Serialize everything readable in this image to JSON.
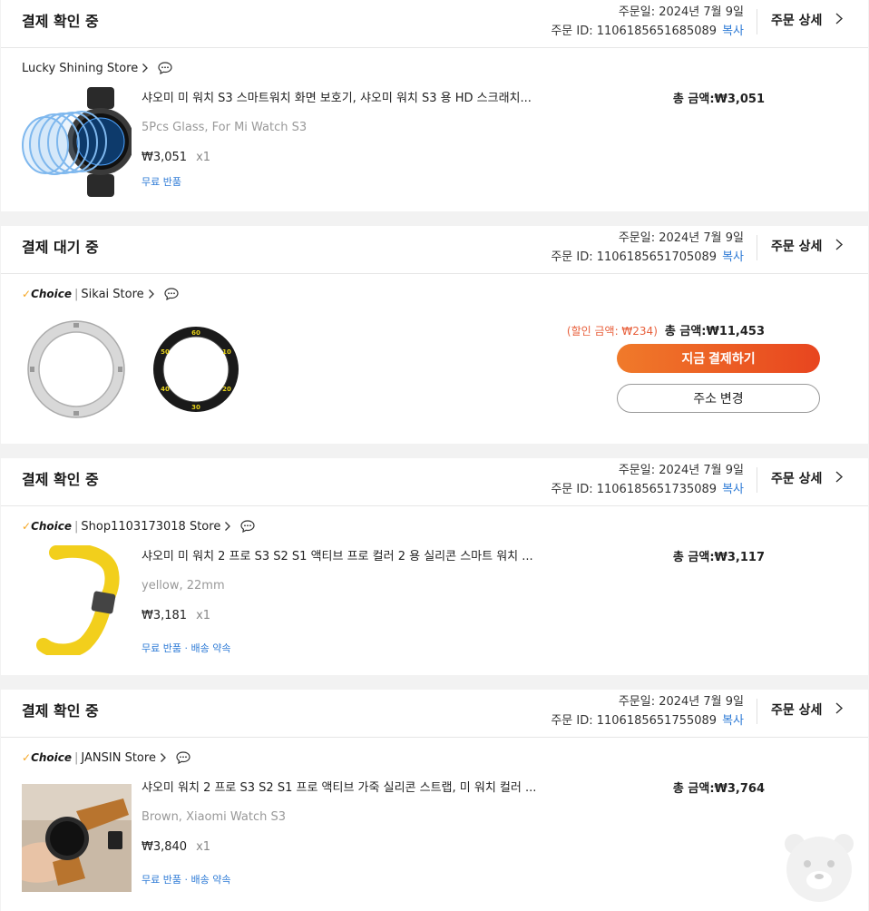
{
  "orders": [
    {
      "status": "결제 확인 중",
      "order_date": "주문일: 2024년 7월 9일",
      "order_id": "주문 ID: 1106185651685089",
      "copy_label": "복사",
      "detail_label": "주문 상세",
      "store": "Lucky Shining Store",
      "choice": false,
      "title": "샤오미 미 워치 S3 스마트워치 화면 보호기, 샤오미 워치 S3 용 HD 스크래치...",
      "variant": "5Pcs Glass, For Mi Watch S3",
      "price": "₩3,051",
      "qty": "x1",
      "benefits": "무료 반품",
      "total": "총 금액:₩3,051"
    },
    {
      "status": "결제 대기 중",
      "order_date": "주문일: 2024년 7월 9일",
      "order_id": "주문 ID: 1106185651705089",
      "copy_label": "복사",
      "detail_label": "주문 상세",
      "store": "Sikai Store",
      "choice": true,
      "choice_label": "Choice",
      "discount": "(할인 금액: ₩234)",
      "total": "총 금액:₩11,453",
      "pay_button": "지금 결제하기",
      "address_button": "주소 변경"
    },
    {
      "status": "결제 확인 중",
      "order_date": "주문일: 2024년 7월 9일",
      "order_id": "주문 ID: 1106185651735089",
      "copy_label": "복사",
      "detail_label": "주문 상세",
      "store": "Shop1103173018 Store",
      "choice": true,
      "choice_label": "Choice",
      "title": "샤오미 미 워치 2 프로 S3 S2 S1 액티브 프로 컬러 2 용 실리콘 스마트 워치 ...",
      "variant": "yellow, 22mm",
      "price": "₩3,181",
      "qty": "x1",
      "benefits": "무료 반품 · 배송 약속",
      "total": "총 금액:₩3,117"
    },
    {
      "status": "결제 확인 중",
      "order_date": "주문일: 2024년 7월 9일",
      "order_id": "주문 ID: 1106185651755089",
      "copy_label": "복사",
      "detail_label": "주문 상세",
      "store": "JANSIN Store",
      "choice": true,
      "choice_label": "Choice",
      "title": "샤오미 워치 2 프로 S3 S2 S1 프로 액티브 가죽 실리콘 스트랩, 미 워치 컬러 ...",
      "variant": "Brown, Xiaomi Watch S3",
      "price": "₩3,840",
      "qty": "x1",
      "benefits": "무료 반품 · 배송 약속",
      "total": "총 금액:₩3,764"
    }
  ],
  "ring_numbers": [
    "60",
    "10",
    "20",
    "30",
    "40",
    "50"
  ],
  "colors": {
    "accent": "#e8451f",
    "link": "#2e7bd6",
    "choice_check": "#f5a623"
  }
}
